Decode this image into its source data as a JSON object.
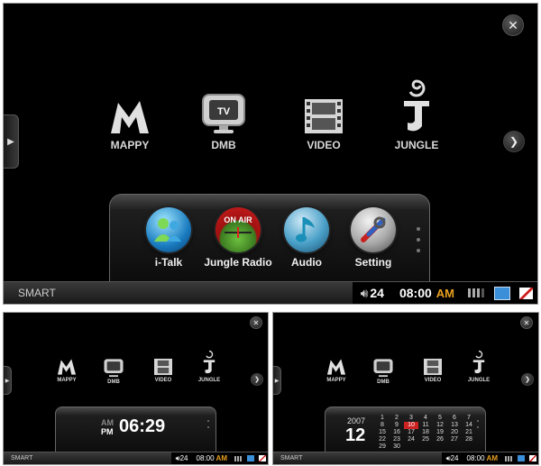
{
  "main": {
    "close_icon": "✕",
    "left_tab_icon": "▶",
    "next_icon": "❯",
    "apps": [
      {
        "label": "MAPPY"
      },
      {
        "label": "DMB"
      },
      {
        "label": "VIDEO"
      },
      {
        "label": "JUNGLE"
      }
    ],
    "dmb_tv_text": "TV",
    "dock": [
      {
        "label": "i-Talk"
      },
      {
        "label": "Jungle Radio",
        "badge": "ON AIR"
      },
      {
        "label": "Audio"
      },
      {
        "label": "Setting"
      }
    ],
    "status": {
      "brand": "SMART",
      "volume": "24",
      "time": "08:00",
      "ampm": "AM"
    }
  },
  "clock_view": {
    "am": "AM",
    "pm": "PM",
    "time": "06:29",
    "status": {
      "brand": "SMART",
      "volume": "24",
      "time": "08:00",
      "ampm": "AM"
    }
  },
  "calendar_view": {
    "year": "2007",
    "day": "12",
    "rows": [
      [
        "1",
        "2",
        "3",
        "4",
        "5",
        "6",
        "7"
      ],
      [
        "8",
        "9",
        "10",
        "11",
        "12",
        "13",
        "14"
      ],
      [
        "15",
        "16",
        "17",
        "18",
        "19",
        "20",
        "21"
      ],
      [
        "22",
        "23",
        "24",
        "25",
        "26",
        "27",
        "28"
      ],
      [
        "29",
        "30",
        "",
        "",
        "",
        "",
        ""
      ]
    ],
    "status": {
      "brand": "SMART",
      "volume": "24",
      "time": "08:00",
      "ampm": "AM"
    }
  },
  "colors": {
    "accent_am": "#e8a020",
    "today_red": "#cc2222"
  }
}
